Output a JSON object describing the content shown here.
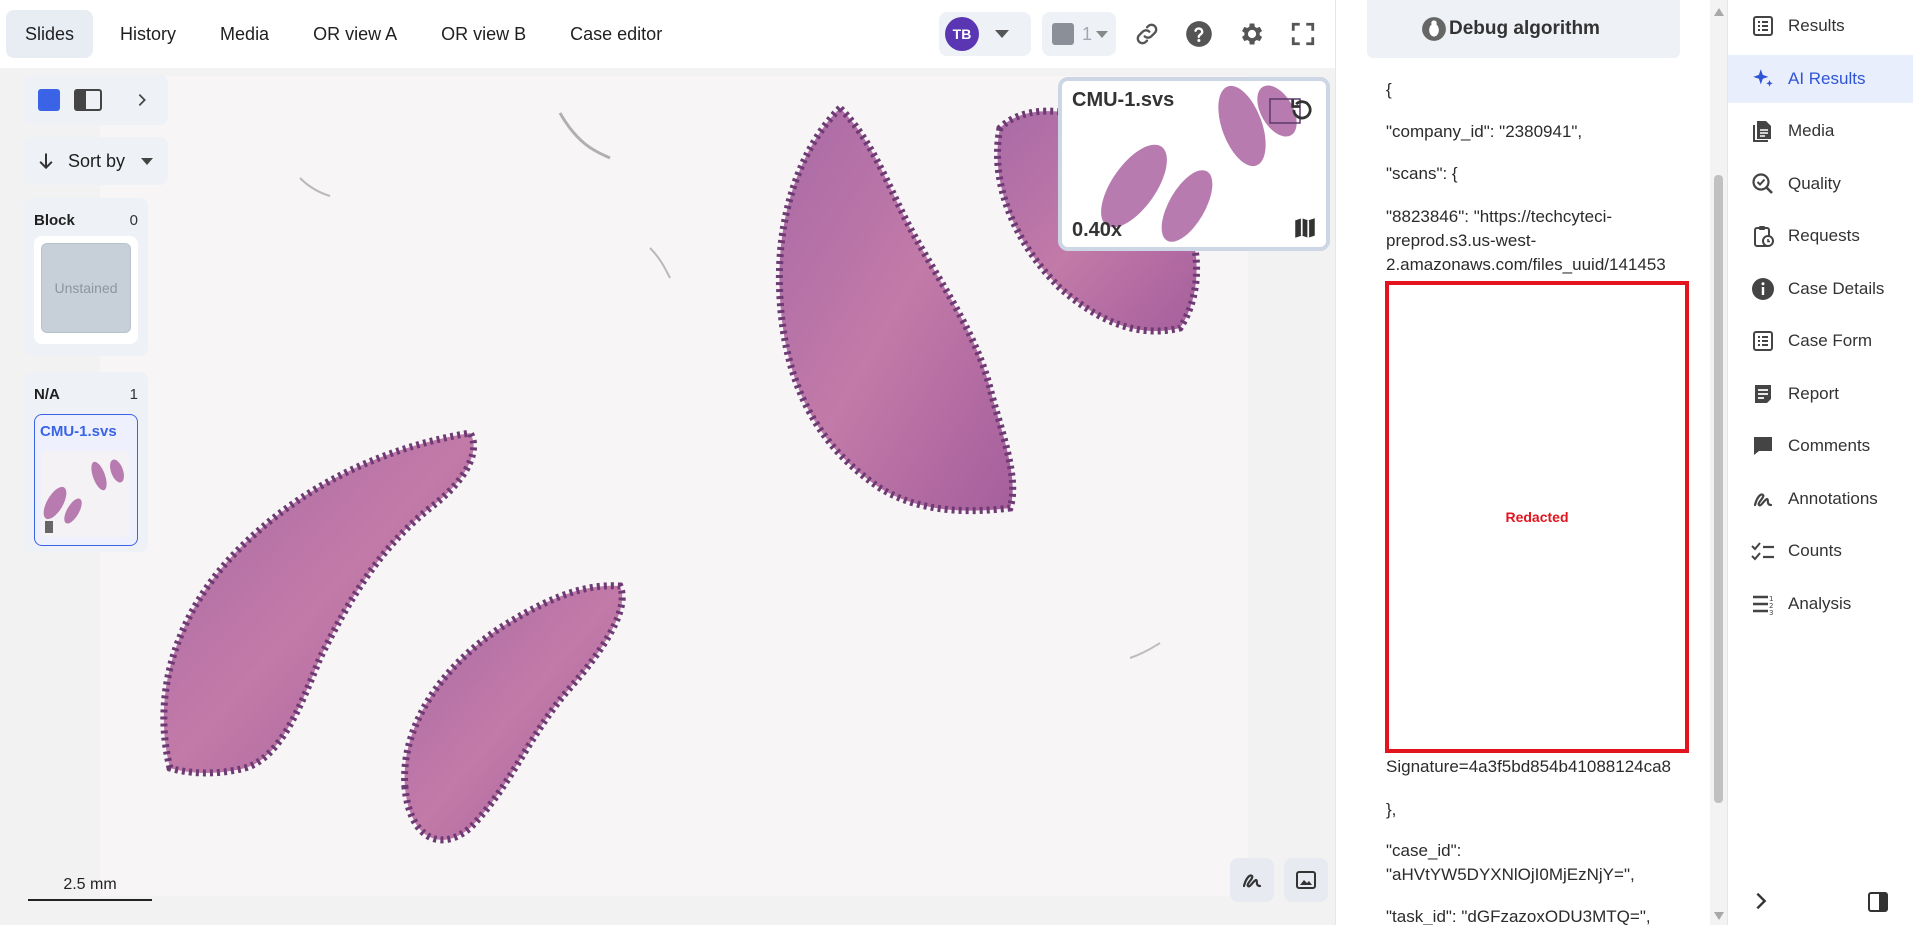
{
  "nav_tabs": [
    {
      "label": "Slides",
      "active": true
    },
    {
      "label": "History"
    },
    {
      "label": "Media"
    },
    {
      "label": "OR view A"
    },
    {
      "label": "OR view B"
    },
    {
      "label": "Case editor"
    }
  ],
  "user": {
    "initials": "TB"
  },
  "layers": {
    "count": "1"
  },
  "sort": {
    "label": "Sort by"
  },
  "slide_groups": [
    {
      "name": "Block",
      "count": "0",
      "slides": [
        {
          "label": "Unstained"
        }
      ]
    },
    {
      "name": "N/A",
      "count": "1",
      "slides": [
        {
          "label": "CMU-1.svs",
          "selected": true
        }
      ]
    }
  ],
  "minimap": {
    "name": "CMU-1.svs",
    "zoom": "0.40x"
  },
  "scalebar": {
    "label": "2.5 mm"
  },
  "debug": {
    "title": "Debug algorithm",
    "lines": [
      "{",
      "\"company_id\": \"2380941\",",
      "\"scans\": {",
      "\"8823846\": \"https://techcyteci-",
      "preprod.s3.us-west-",
      "2.amazonaws.com/files_uuid/141453",
      "Signature=4a3f5bd854b41088124ca8",
      "},",
      "\"case_id\":",
      "\"aHVtYW5DYXNlOjI0MjEzNjY=\",",
      "\"task_id\": \"dGFzazoxODU3MTQ=\","
    ],
    "redacted_label": "Redacted"
  },
  "side_nav": [
    {
      "label": "Results",
      "icon": "results-list-icon"
    },
    {
      "label": "AI Results",
      "icon": "sparkles-icon",
      "active": true
    },
    {
      "label": "Media",
      "icon": "media-files-icon"
    },
    {
      "label": "Quality",
      "icon": "quality-check-icon"
    },
    {
      "label": "Requests",
      "icon": "clipboard-clock-icon"
    },
    {
      "label": "Case Details",
      "icon": "info-icon"
    },
    {
      "label": "Case Form",
      "icon": "form-list-icon"
    },
    {
      "label": "Report",
      "icon": "report-icon"
    },
    {
      "label": "Comments",
      "icon": "comment-icon"
    },
    {
      "label": "Annotations",
      "icon": "annotation-squiggle-icon"
    },
    {
      "label": "Counts",
      "icon": "checklist-icon"
    },
    {
      "label": "Analysis",
      "icon": "numbered-list-icon"
    }
  ],
  "colors": {
    "accent": "#3b63e6",
    "redact": "#e3141d",
    "avatar": "#5b36b3",
    "active_nav_bg": "#e9eefc"
  }
}
